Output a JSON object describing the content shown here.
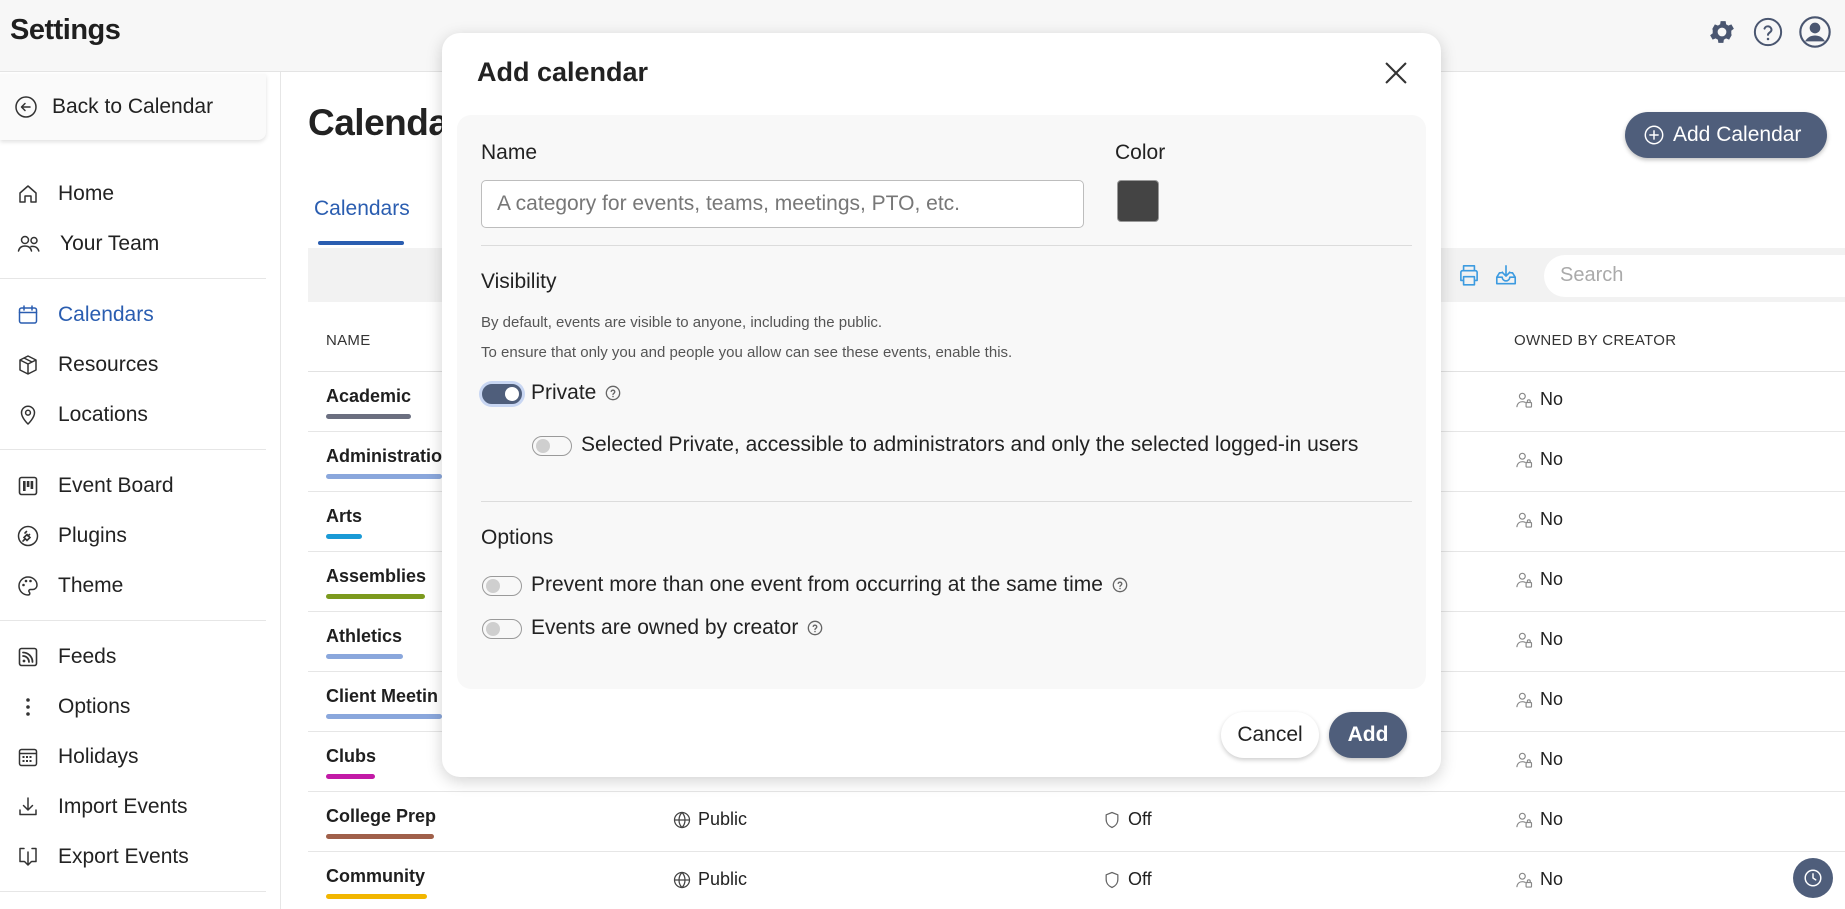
{
  "header": {
    "title": "Settings",
    "icons": [
      "gear-icon",
      "help-icon",
      "user-avatar-icon"
    ]
  },
  "sidebar": {
    "back_label": "Back to Calendar",
    "items": [
      {
        "label": "Home",
        "icon": "home-icon"
      },
      {
        "label": "Your Team",
        "icon": "team-icon"
      },
      {
        "label": "Calendars",
        "icon": "calendar-icon",
        "active": true
      },
      {
        "label": "Resources",
        "icon": "box-icon"
      },
      {
        "label": "Locations",
        "icon": "location-pin-icon"
      },
      {
        "label": "Event Board",
        "icon": "board-icon"
      },
      {
        "label": "Plugins",
        "icon": "plugin-icon"
      },
      {
        "label": "Theme",
        "icon": "palette-icon"
      },
      {
        "label": "Feeds",
        "icon": "rss-icon"
      },
      {
        "label": "Options",
        "icon": "kebab-icon"
      },
      {
        "label": "Holidays",
        "icon": "calendar-grid-icon"
      },
      {
        "label": "Import Events",
        "icon": "download-icon"
      },
      {
        "label": "Export Events",
        "icon": "export-icon"
      }
    ]
  },
  "main": {
    "title": "Calenda",
    "add_calendar_label": "Add Calendar",
    "tab_label": "Calendars",
    "search_placeholder": "Search",
    "columns": {
      "name": "NAME",
      "owned": "OWNED BY CREATOR"
    },
    "rows": [
      {
        "name": "Academic",
        "visibility": "",
        "conflict": "",
        "owned": "No",
        "color": "#6b6f80"
      },
      {
        "name": "Administratio",
        "visibility": "",
        "conflict": "",
        "owned": "No",
        "color": "#8aa7dc"
      },
      {
        "name": "Arts",
        "visibility": "",
        "conflict": "",
        "owned": "No",
        "color": "#1a9ad6"
      },
      {
        "name": "Assemblies",
        "visibility": "",
        "conflict": "",
        "owned": "No",
        "color": "#7c9a1e"
      },
      {
        "name": "Athletics",
        "visibility": "",
        "conflict": "",
        "owned": "No",
        "color": "#8aa7dc"
      },
      {
        "name": "Client Meetin",
        "visibility": "",
        "conflict": "",
        "owned": "No",
        "color": "#8aa7dc"
      },
      {
        "name": "Clubs",
        "visibility": "",
        "conflict": "",
        "owned": "No",
        "color": "#c21aa6"
      },
      {
        "name": "College Prep",
        "visibility": "Public",
        "conflict": "Off",
        "owned": "No",
        "color": "#a0604a"
      },
      {
        "name": "Community",
        "visibility": "Public",
        "conflict": "Off",
        "owned": "No",
        "color": "#f2b600"
      }
    ]
  },
  "modal": {
    "title": "Add calendar",
    "name_label": "Name",
    "name_placeholder": "A category for events, teams, meetings, PTO, etc.",
    "color_label": "Color",
    "color_value": "#444444",
    "visibility_heading": "Visibility",
    "visibility_help_1": "By default, events are visible to anyone, including the public.",
    "visibility_help_2": "To ensure that only you and people you allow can see these events, enable this.",
    "private_label": "Private",
    "private_on": true,
    "selected_private_label": "Selected Private, accessible to administrators and only the selected logged-in users",
    "options_heading": "Options",
    "prevent_label": "Prevent more than one event from occurring at the same time",
    "owned_label": "Events are owned by creator",
    "cancel_label": "Cancel",
    "add_label": "Add"
  },
  "colors": {
    "accent": "#4f5e7b",
    "link": "#2a5db0"
  }
}
